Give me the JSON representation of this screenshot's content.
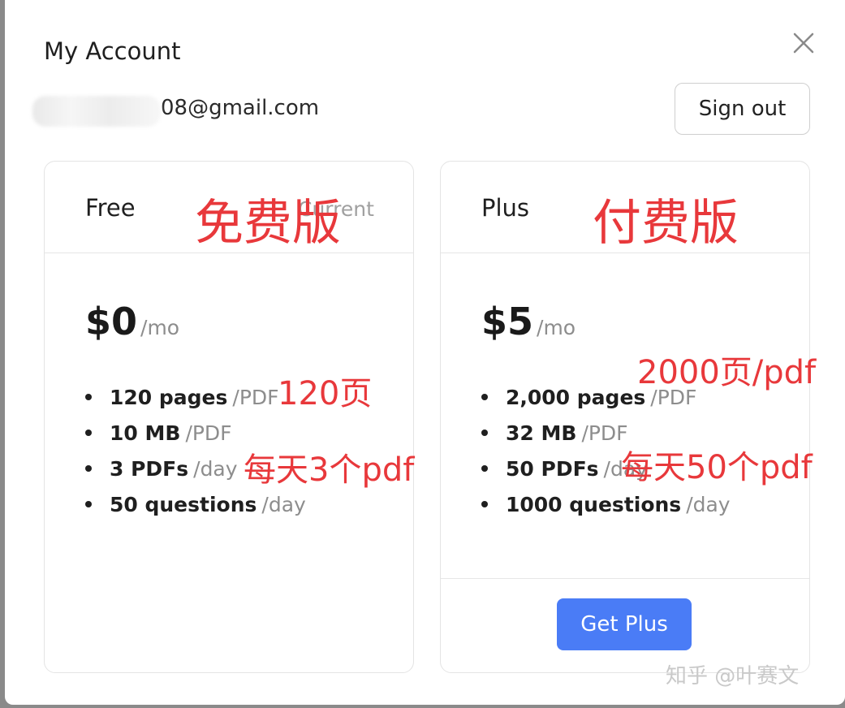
{
  "dialog": {
    "title": "My Account",
    "email": "08@gmail.com",
    "sign_out_label": "Sign out",
    "close_icon": "close-icon"
  },
  "plans": {
    "free": {
      "name": "Free",
      "current_label": "Current",
      "price": "$0",
      "price_unit": "/mo",
      "features": [
        {
          "value": "120 pages",
          "unit": "/PDF"
        },
        {
          "value": "10 MB",
          "unit": "/PDF"
        },
        {
          "value": "3 PDFs",
          "unit": "/day"
        },
        {
          "value": "50 questions",
          "unit": "/day"
        }
      ]
    },
    "plus": {
      "name": "Plus",
      "price": "$5",
      "price_unit": "/mo",
      "features": [
        {
          "value": "2,000 pages",
          "unit": "/PDF"
        },
        {
          "value": "32 MB",
          "unit": "/PDF"
        },
        {
          "value": "50 PDFs",
          "unit": "/day"
        },
        {
          "value": "1000 questions",
          "unit": "/day"
        }
      ],
      "button_label": "Get Plus"
    }
  },
  "annotations": {
    "free_title": "免费版",
    "plus_title": "付费版",
    "free_pages": "120页",
    "free_pdfs": "每天3个pdf",
    "plus_pages": "2000页/pdf",
    "plus_pdfs": "每天50个pdf"
  },
  "watermark": "知乎 @叶赛文",
  "colors": {
    "accent": "#4a7cf6",
    "annotation": "#e8383b"
  }
}
